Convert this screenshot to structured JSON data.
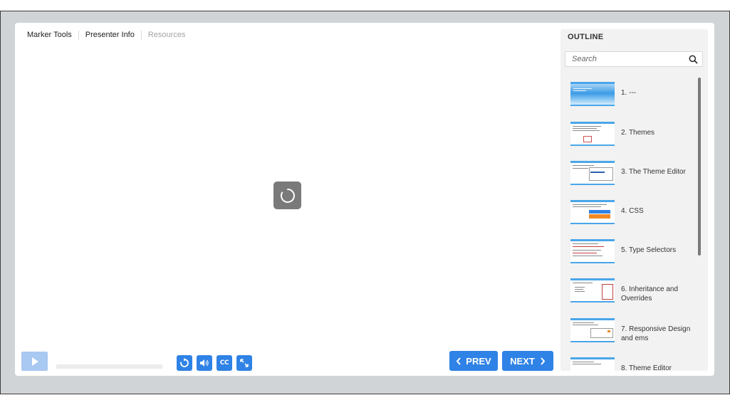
{
  "tabs": {
    "marker_tools": "Marker Tools",
    "presenter_info": "Presenter Info",
    "resources": "Resources"
  },
  "player": {
    "play_icon": "play-icon",
    "progress": 0,
    "loading_icon": "loading-spinner-icon"
  },
  "controls": {
    "replay_icon": "replay-icon",
    "volume_icon": "volume-icon",
    "cc_label": "CC",
    "fullscreen_icon": "fullscreen-icon"
  },
  "nav": {
    "prev_label": "PREV",
    "next_label": "NEXT"
  },
  "outline": {
    "title": "OUTLINE",
    "search_placeholder": "Search",
    "items": [
      {
        "label": "1. ---"
      },
      {
        "label": "2. Themes"
      },
      {
        "label": "3. The Theme Editor"
      },
      {
        "label": "4. CSS"
      },
      {
        "label": "5. Type Selectors"
      },
      {
        "label": "6. Inheritance and Overrides"
      },
      {
        "label": "7. Responsive Design and ems"
      },
      {
        "label": "8. Theme Editor"
      }
    ]
  },
  "colors": {
    "accent": "#2f82e6",
    "play_disabled": "#a9c8f2",
    "frame": "#d0d4d6",
    "sidebar": "#f2f2f2"
  }
}
